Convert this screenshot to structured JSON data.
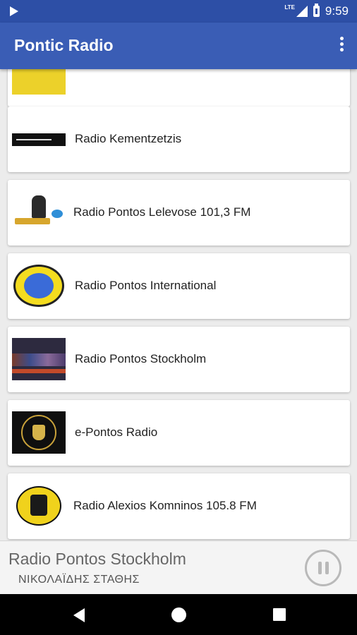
{
  "status_bar": {
    "network_badge": "LTE",
    "time": "9:59"
  },
  "app_bar": {
    "title": "Pontic Radio"
  },
  "stations": [
    {
      "name": ""
    },
    {
      "name": "Radio Kementzetzis"
    },
    {
      "name": "Radio Pontos Lelevose 101,3 FM"
    },
    {
      "name": "Radio Pontos International"
    },
    {
      "name": "Radio Pontos Stockholm"
    },
    {
      "name": "e-Pontos Radio"
    },
    {
      "name": "Radio Alexios Komninos 105.8 FM"
    }
  ],
  "now_playing": {
    "title": "Radio Pontos Stockholm",
    "subtitle": "ΝΙΚΟΛΑΪΔΗΣ ΣΤΑΘΗΣ"
  },
  "colors": {
    "status_bar": "#2d4fa6",
    "app_bar": "#3a5db5",
    "background": "#ececec"
  }
}
